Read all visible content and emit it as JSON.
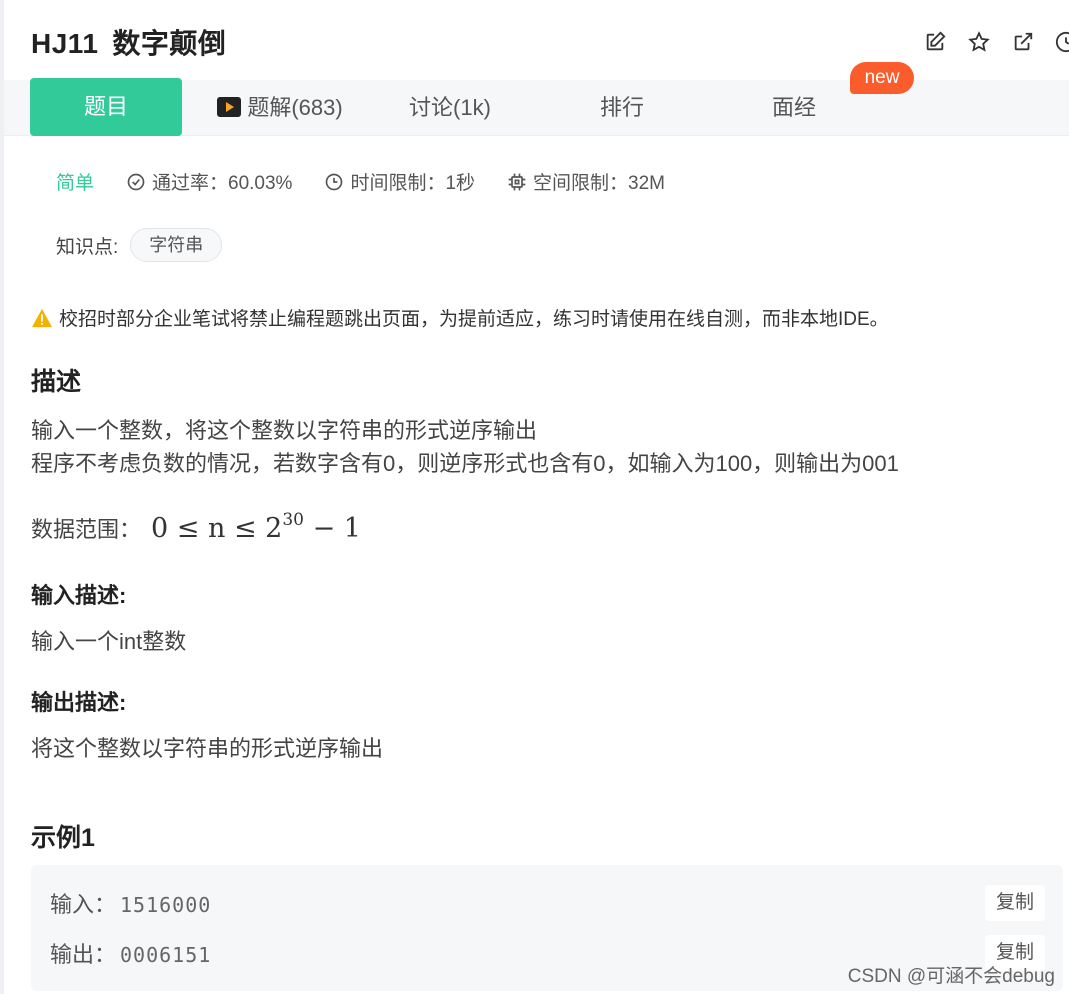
{
  "problem": {
    "id": "HJ11",
    "title": "数字颠倒"
  },
  "header_icons": [
    "edit-icon",
    "star-icon",
    "external-link-icon",
    "clock-icon"
  ],
  "tabs": [
    {
      "label": "题目",
      "active": true
    },
    {
      "label": "题解(683)",
      "icon": "video-icon"
    },
    {
      "label": "讨论(1k)"
    },
    {
      "label": "排行"
    },
    {
      "label": "面经"
    }
  ],
  "new_badge": "new",
  "meta": {
    "difficulty": "简单",
    "pass_rate": "通过率：60.03%",
    "time_limit": "时间限制：1秒",
    "space_limit": "空间限制：32M"
  },
  "knowledge": {
    "label": "知识点:",
    "tags": [
      "字符串"
    ]
  },
  "warning": "校招时部分企业笔试将禁止编程题跳出页面，为提前适应，练习时请使用在线自测，而非本地IDE。",
  "description": {
    "heading": "描述",
    "lines": [
      "输入一个整数，将这个整数以字符串的形式逆序输出",
      "程序不考虑负数的情况，若数字含有0，则逆序形式也含有0，如输入为100，则输出为001"
    ],
    "range_label": "数据范围：",
    "range_math_pre": "0 ≤ n ≤ 2",
    "range_math_exp": "30",
    "range_math_post": " − 1"
  },
  "input_desc": {
    "heading": "输入描述:",
    "text": "输入一个int整数"
  },
  "output_desc": {
    "heading": "输出描述:",
    "text": "将这个整数以字符串的形式逆序输出"
  },
  "example": {
    "heading": "示例1",
    "input_label": "输入：",
    "input_value": "1516000",
    "output_label": "输出：",
    "output_value": "0006151",
    "copy_label": "复制"
  },
  "watermark": "CSDN @可涵不会debug",
  "colors": {
    "accent": "#32ca99",
    "badge": "#fa5c2c",
    "warning": "#f5b100"
  }
}
